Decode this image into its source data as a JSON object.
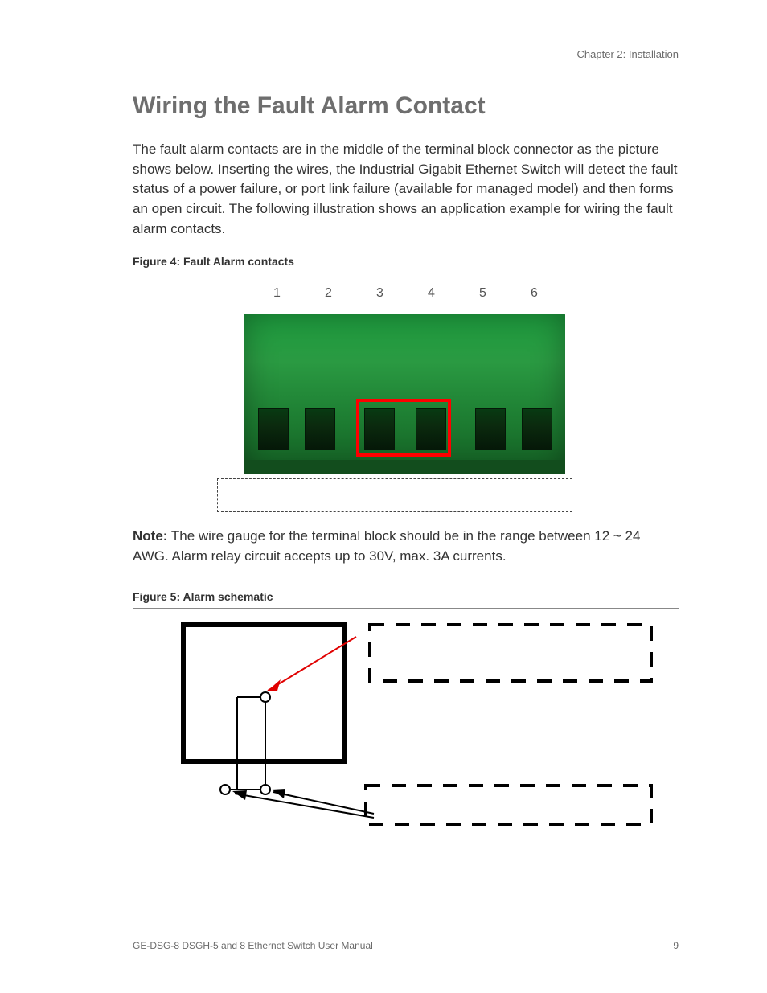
{
  "header": {
    "chapter": "Chapter 2: Installation"
  },
  "section": {
    "title": "Wiring the Fault Alarm Contact",
    "paragraph": "The fault alarm contacts are in the middle of the terminal block connector as the picture shows below. Inserting the wires, the Industrial Gigabit Ethernet Switch will detect the fault status of a power failure, or port link failure (available for managed model) and then forms an open circuit. The following illustration shows an application example for wiring the fault alarm contacts."
  },
  "figure4": {
    "caption": "Figure 4: Fault Alarm contacts",
    "labels": [
      "1",
      "2",
      "3",
      "4",
      "5",
      "6"
    ]
  },
  "note": {
    "label": "Note:",
    "text": "The wire gauge for the terminal block should be in the range between 12 ~ 24 AWG.  Alarm relay circuit accepts up to 30V, max. 3A currents."
  },
  "figure5": {
    "caption": "Figure 5: Alarm schematic"
  },
  "footer": {
    "manual": "GE-DSG-8 DSGH-5 and 8 Ethernet Switch User Manual",
    "page": "9"
  }
}
